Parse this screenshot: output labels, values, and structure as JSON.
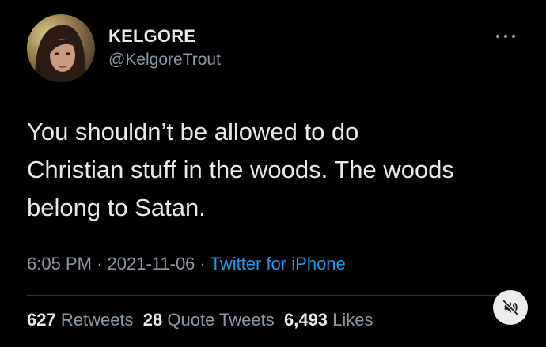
{
  "author": {
    "display_name": "KELGORE",
    "handle": "@KelgoreTrout",
    "avatar_icon": "profile-photo"
  },
  "tweet": {
    "text": "You shouldn’t be allowed to do\nChristian stuff in the woods. The woods\nbelong to Satan."
  },
  "meta": {
    "time": "6:05 PM",
    "separator": "·",
    "date": "2021-11-06",
    "source": "Twitter for iPhone"
  },
  "stats": {
    "retweets_count": "627",
    "retweets_label": "Retweets",
    "quote_count": "28",
    "quote_label": "Quote Tweets",
    "likes_count": "6,493",
    "likes_label": "Likes"
  },
  "icons": {
    "more": "more-dots-icon",
    "mute": "muted-speaker-icon"
  },
  "colors": {
    "background": "#000000",
    "primary_text": "#e7e9ea",
    "secondary_text": "#8b98a5",
    "link": "#1d9bf0",
    "divider": "#2f3336"
  }
}
